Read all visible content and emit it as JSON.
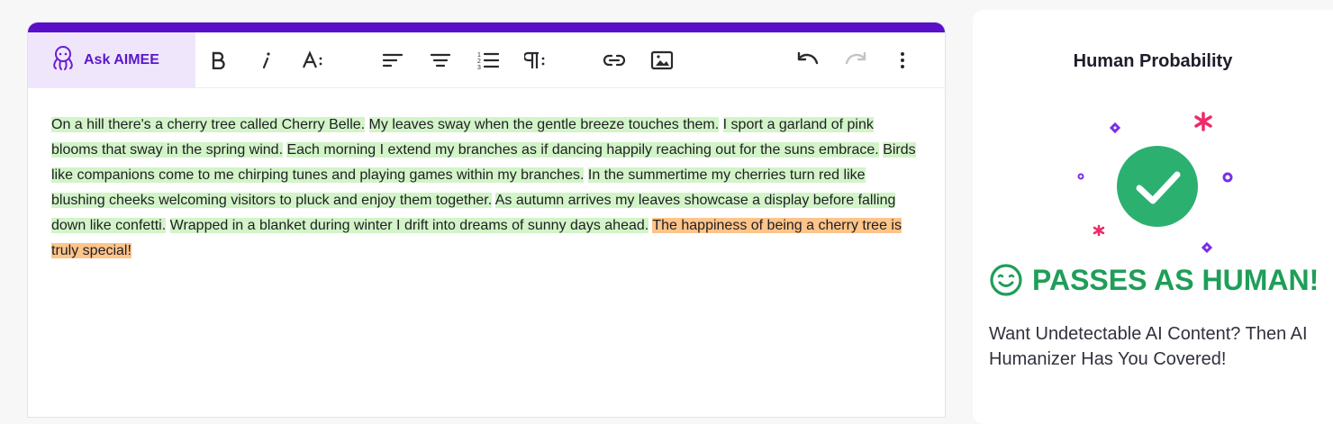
{
  "toolbar": {
    "ask_label": "Ask AIMEE",
    "icons": [
      "octopus-icon",
      "bold-icon",
      "italic-icon",
      "font-size-icon",
      "align-left-icon",
      "align-center-icon",
      "numbered-list-icon",
      "paragraph-icon",
      "link-icon",
      "image-icon",
      "undo-icon",
      "redo-icon",
      "more-icon"
    ]
  },
  "editor": {
    "segments": [
      {
        "text": "On a hill there's a cherry tree called Cherry Belle.",
        "status": "human"
      },
      {
        "text": "My leaves sway when the gentle breeze touches them.",
        "status": "human"
      },
      {
        "text": "I sport a garland of pink blooms that sway in the spring wind.",
        "status": "human"
      },
      {
        "text": "Each morning I extend my branches as if dancing happily reaching out for the suns embrace.",
        "status": "human"
      },
      {
        "text": "Birds like companions come to me chirping tunes and playing games within my branches.",
        "status": "human"
      },
      {
        "text": "In the summertime my cherries turn red like blushing cheeks welcoming visitors to pluck and enjoy them together.",
        "status": "human"
      },
      {
        "text": "As autumn arrives my leaves showcase a display before falling down like confetti.",
        "status": "human"
      },
      {
        "text": "Wrapped in a blanket during winter I drift into dreams of sunny days ahead.",
        "status": "human"
      },
      {
        "text": "The happiness of being a cherry tree is truly special!",
        "status": "warning"
      }
    ],
    "colors": {
      "human": "#d2f4c8",
      "warning": "#ffc48a",
      "accent": "#5a0fc8"
    }
  },
  "result": {
    "title": "Human Probability",
    "verdict": "PASSES AS HUMAN!",
    "verdict_color": "#1f9e58",
    "promo": "Want Undetectable AI Content? Then AI Humanizer Has You Covered!"
  }
}
